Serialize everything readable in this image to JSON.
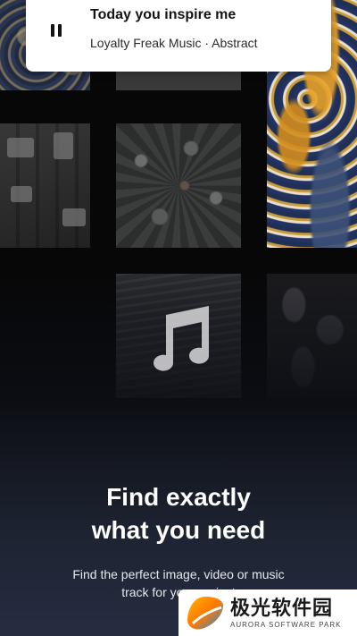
{
  "now_playing": {
    "title": "Today you inspire me",
    "subtitle": "Loyalty Freak Music · Abstract",
    "control_icon": "pause-icon"
  },
  "onboarding": {
    "headline_line1": "Find exactly",
    "headline_line2": "what you need",
    "description_line1": "Find the perfect image, video or music",
    "description_line2": "track for your project"
  },
  "center_icon": "music-note-icon",
  "watermark": {
    "chinese": "极光软件园",
    "english": "AURORA SOFTWARE PARK"
  }
}
